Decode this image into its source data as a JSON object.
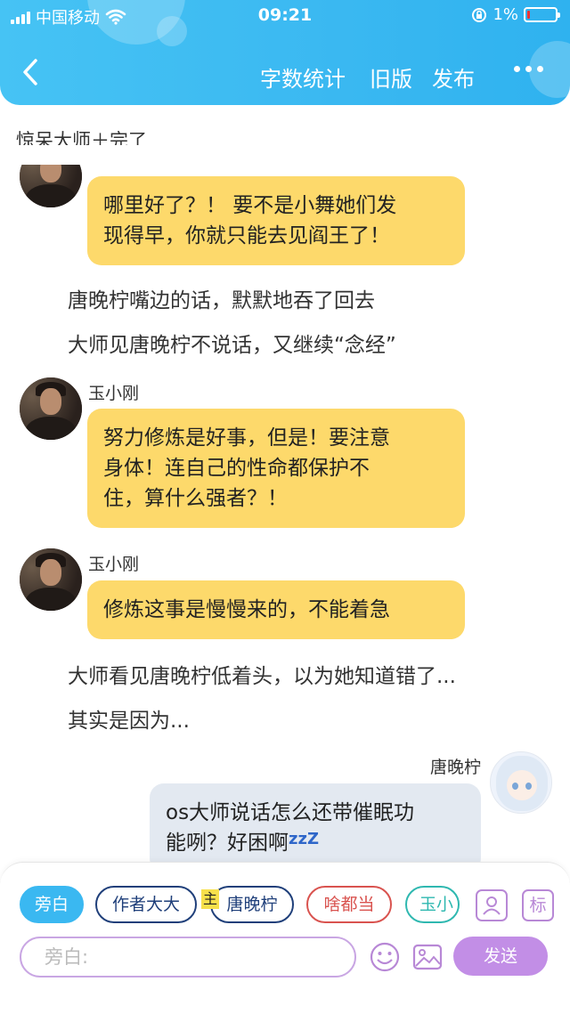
{
  "status": {
    "carrier": "中国移动",
    "time": "09:21",
    "battery": "1%"
  },
  "nav": {
    "word_count": "字数统计",
    "old_version": "旧版",
    "publish": "发布"
  },
  "subtitle": "惊呆大师＋完了",
  "messages": [
    {
      "type": "bubble",
      "speaker": "",
      "text_lines": [
        "哪里好了？！ 要不是小舞她们发",
        "现得早，你就只能去见阎王了！"
      ]
    },
    {
      "type": "narration",
      "text": "唐晚柠嘴边的话，默默地吞了回去"
    },
    {
      "type": "narration",
      "text": "大师见唐晚柠不说话，又继续“念经”"
    },
    {
      "type": "bubble",
      "speaker": "玉小刚",
      "text_lines": [
        "努力修炼是好事，但是！要注意",
        "身体！连自己的性命都保护不",
        "住，算什么强者？！"
      ]
    },
    {
      "type": "bubble",
      "speaker": "玉小刚",
      "text_lines": [
        "修炼这事是慢慢来的，不能着急"
      ]
    },
    {
      "type": "narration",
      "text": "大师看见唐晚柠低着头，以为她知道错了..."
    },
    {
      "type": "narration",
      "text": "其实是因为..."
    },
    {
      "type": "self_bubble",
      "speaker": "唐晚柠",
      "text_lines": [
        "os大师说话怎么还带催眠功",
        "能咧？好困啊"
      ],
      "zzz": "zzZ"
    }
  ],
  "roles": [
    {
      "label": "旁白",
      "active": true
    },
    {
      "label": "作者大大",
      "active": false
    },
    {
      "label": "唐晚柠",
      "active": false,
      "tag": "主"
    },
    {
      "label": "啥都当",
      "active": false
    },
    {
      "label": "玉小刚",
      "active": false
    }
  ],
  "tools": {
    "biao": "标"
  },
  "input": {
    "placeholder": "旁白:"
  },
  "send_label": "发送",
  "colors": {
    "header": "#3ab8f1",
    "bubble": "#fdd96b",
    "self_bubble": "#e3e9f1",
    "send": "#c28ee6"
  }
}
